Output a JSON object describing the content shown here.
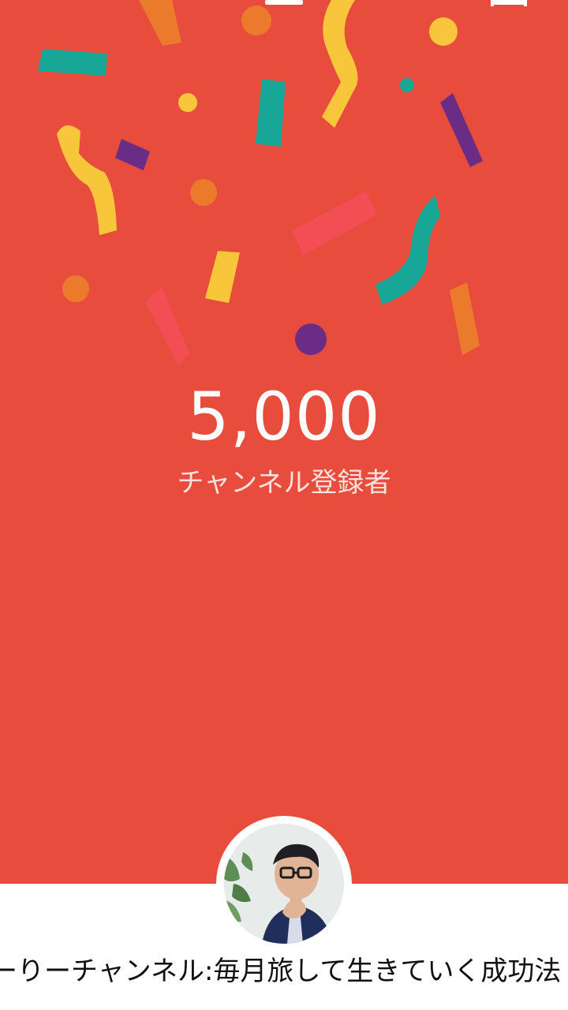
{
  "theme": {
    "background": "#E84C3D",
    "text": "#FFFFFF",
    "label_text": "#FDE2DE",
    "lower_panel": "#FFFFFF"
  },
  "milestone": {
    "count": "5,000",
    "label": "チャンネル登録者"
  },
  "channel": {
    "name": "ーりーチャンネル:毎月旅して生きていく成功法",
    "avatar_icon": "profile-photo-icon"
  },
  "decoration": {
    "icon": "confetti-icon"
  }
}
